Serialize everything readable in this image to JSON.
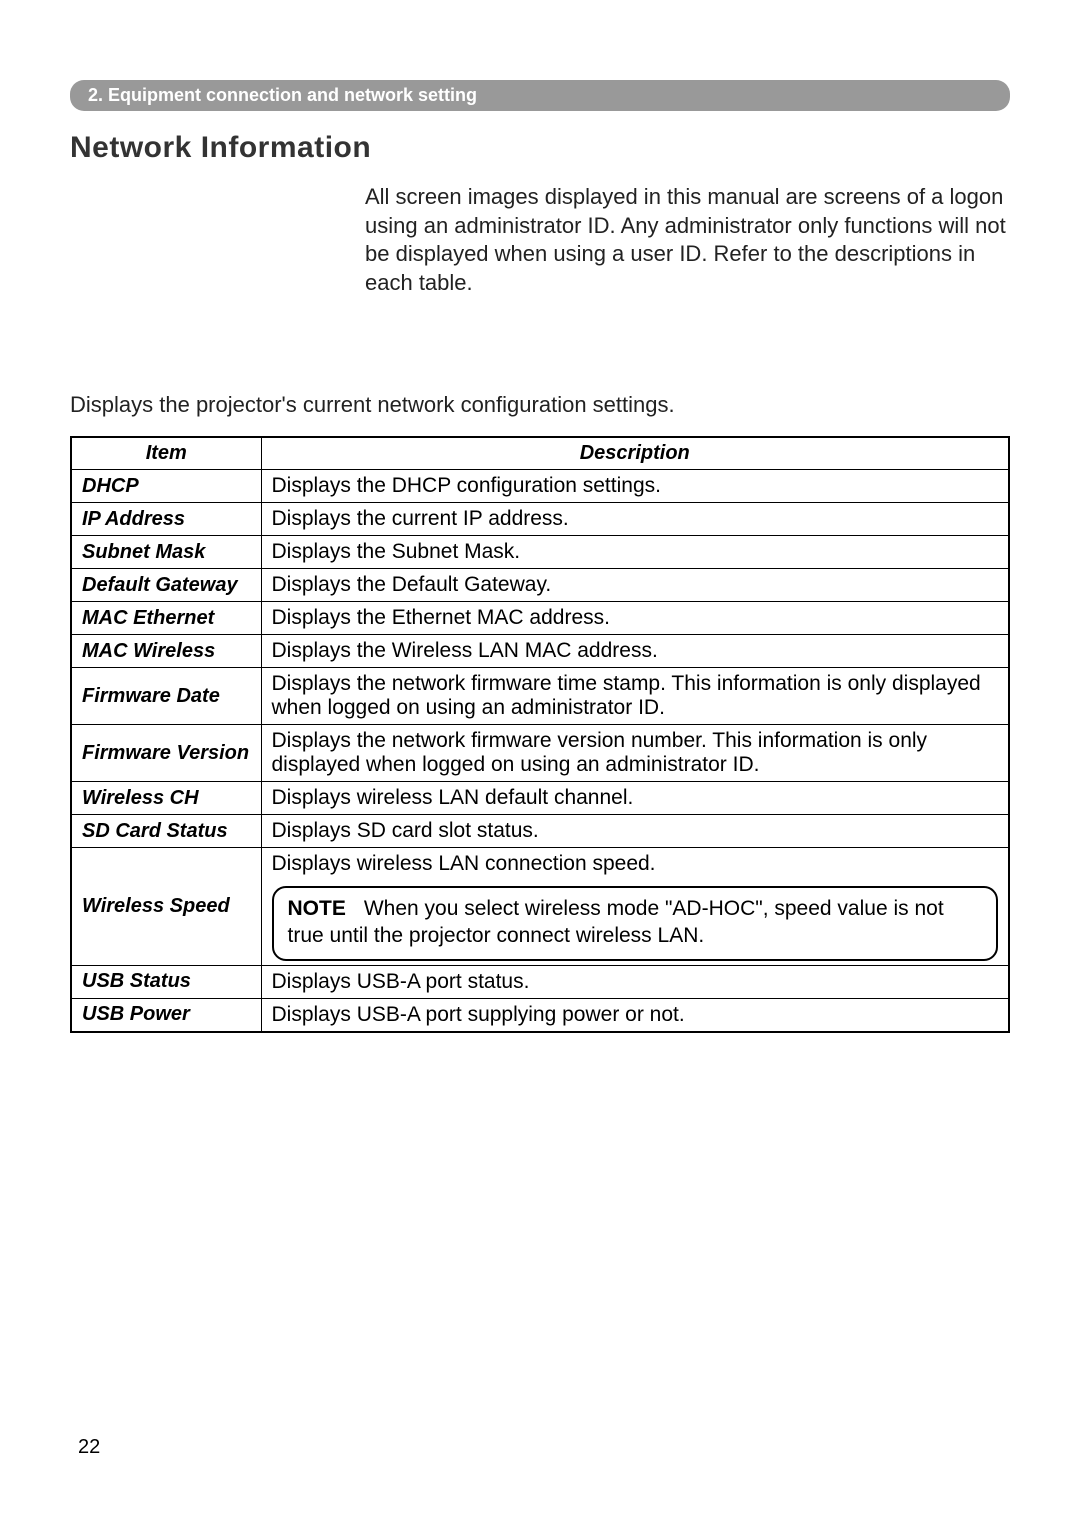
{
  "section_header": "2. Equipment connection and network setting",
  "title": "Network Information",
  "intro": "All screen images displayed in this manual are screens of a logon using an administrator ID. Any administrator only functions will not be displayed when using a user ID. Refer to the descriptions in each table.",
  "subtitle": "Displays the projector's current network configuration settings.",
  "table": {
    "headers": {
      "col1": "Item",
      "col2": "Description"
    },
    "rows": [
      {
        "item": "DHCP",
        "desc": "Displays the DHCP configuration settings."
      },
      {
        "item": "IP Address",
        "desc": "Displays the current IP address."
      },
      {
        "item": "Subnet Mask",
        "desc": "Displays the Subnet Mask."
      },
      {
        "item": "Default Gateway",
        "desc": "Displays the Default Gateway."
      },
      {
        "item": "MAC Ethernet",
        "desc": "Displays the Ethernet MAC address."
      },
      {
        "item": "MAC Wireless",
        "desc": "Displays the Wireless LAN MAC address."
      },
      {
        "item": "Firmware Date",
        "desc": "Displays the network firmware time stamp. This information is only displayed when logged on using an administrator ID."
      },
      {
        "item": "Firmware Version",
        "desc": "Displays the network firmware version number. This information is only displayed when logged on using an administrator ID."
      },
      {
        "item": "Wireless CH",
        "desc": "Displays wireless LAN default channel."
      },
      {
        "item": "SD Card Status",
        "desc": "Displays SD card slot status."
      },
      {
        "item": "Wireless Speed",
        "desc_top": "Displays wireless LAN connection speed.",
        "note_label": "NOTE",
        "note_body": "When you select wireless mode \"AD-HOC\", speed value is not true until the projector connect wireless LAN."
      },
      {
        "item": "USB Status",
        "desc": "Displays USB-A port status."
      },
      {
        "item": "USB Power",
        "desc": "Displays USB-A port supplying power or not."
      }
    ]
  },
  "page_number": "22"
}
